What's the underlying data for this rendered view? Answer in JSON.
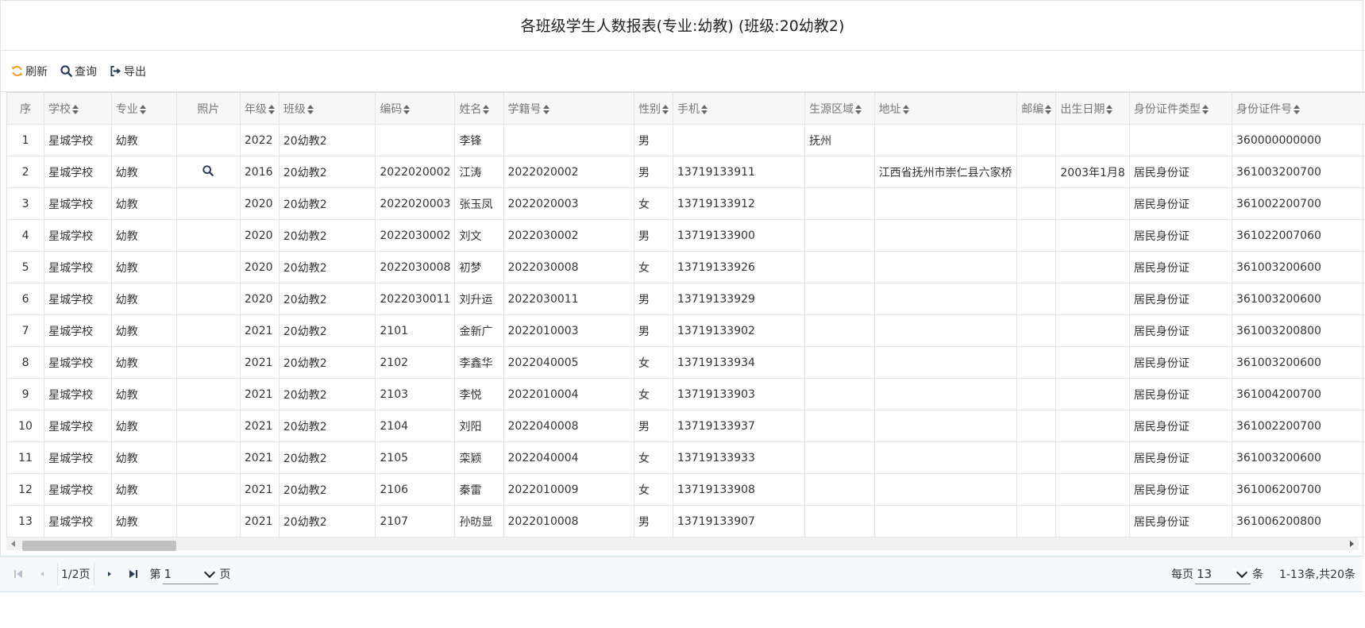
{
  "report": {
    "title": "各班级学生人数报表(专业:幼教) (班级:20幼教2)"
  },
  "toolbar": {
    "refresh_label": "刷新",
    "query_label": "查询",
    "export_label": "导出",
    "refresh_color": "#f0a030"
  },
  "table": {
    "columns": [
      "序",
      "学校",
      "专业",
      "照片",
      "年级",
      "班级",
      "编码",
      "姓名",
      "学籍号",
      "性别",
      "手机",
      "生源区域",
      "地址",
      "邮编",
      "出生日期",
      "身份证件类型",
      "身份证件号"
    ],
    "rows": [
      {
        "seq": "1",
        "school": "星城学校",
        "major": "幼教",
        "photo": "",
        "grade": "2022",
        "class": "20幼教2",
        "code": "",
        "name": "李锋",
        "sid": "",
        "gender": "男",
        "phone": "",
        "region": "抚州",
        "addr": "",
        "zip": "",
        "birth": "",
        "idtype": "",
        "idno": "360000000000"
      },
      {
        "seq": "2",
        "school": "星城学校",
        "major": "幼教",
        "photo": "search-icon",
        "grade": "2016",
        "class": "20幼教2",
        "code": "2022020002",
        "name": "江涛",
        "sid": "2022020002",
        "gender": "男",
        "phone": "13719133911",
        "region": "",
        "addr": "江西省抚州市崇仁县六家桥",
        "zip": "",
        "birth": "2003年1月8",
        "idtype": "居民身份证",
        "idno": "361003200700"
      },
      {
        "seq": "3",
        "school": "星城学校",
        "major": "幼教",
        "photo": "",
        "grade": "2020",
        "class": "20幼教2",
        "code": "2022020003",
        "name": "张玉凤",
        "sid": "2022020003",
        "gender": "女",
        "phone": "13719133912",
        "region": "",
        "addr": "",
        "zip": "",
        "birth": "",
        "idtype": "居民身份证",
        "idno": "361002200700"
      },
      {
        "seq": "4",
        "school": "星城学校",
        "major": "幼教",
        "photo": "",
        "grade": "2020",
        "class": "20幼教2",
        "code": "2022030002",
        "name": "刘文",
        "sid": "2022030002",
        "gender": "男",
        "phone": "13719133900",
        "region": "",
        "addr": "",
        "zip": "",
        "birth": "",
        "idtype": "居民身份证",
        "idno": "361022007060"
      },
      {
        "seq": "5",
        "school": "星城学校",
        "major": "幼教",
        "photo": "",
        "grade": "2020",
        "class": "20幼教2",
        "code": "2022030008",
        "name": "初梦",
        "sid": "2022030008",
        "gender": "女",
        "phone": "13719133926",
        "region": "",
        "addr": "",
        "zip": "",
        "birth": "",
        "idtype": "居民身份证",
        "idno": "361003200600"
      },
      {
        "seq": "6",
        "school": "星城学校",
        "major": "幼教",
        "photo": "",
        "grade": "2020",
        "class": "20幼教2",
        "code": "2022030011",
        "name": "刘升运",
        "sid": "2022030011",
        "gender": "男",
        "phone": "13719133929",
        "region": "",
        "addr": "",
        "zip": "",
        "birth": "",
        "idtype": "居民身份证",
        "idno": "361003200600"
      },
      {
        "seq": "7",
        "school": "星城学校",
        "major": "幼教",
        "photo": "",
        "grade": "2021",
        "class": "20幼教2",
        "code": "2101",
        "name": "金新广",
        "sid": "2022010003",
        "gender": "男",
        "phone": "13719133902",
        "region": "",
        "addr": "",
        "zip": "",
        "birth": "",
        "idtype": "居民身份证",
        "idno": "361003200800"
      },
      {
        "seq": "8",
        "school": "星城学校",
        "major": "幼教",
        "photo": "",
        "grade": "2021",
        "class": "20幼教2",
        "code": "2102",
        "name": "李鑫华",
        "sid": "2022040005",
        "gender": "女",
        "phone": "13719133934",
        "region": "",
        "addr": "",
        "zip": "",
        "birth": "",
        "idtype": "居民身份证",
        "idno": "361003200600"
      },
      {
        "seq": "9",
        "school": "星城学校",
        "major": "幼教",
        "photo": "",
        "grade": "2021",
        "class": "20幼教2",
        "code": "2103",
        "name": "李悦",
        "sid": "2022010004",
        "gender": "女",
        "phone": "13719133903",
        "region": "",
        "addr": "",
        "zip": "",
        "birth": "",
        "idtype": "居民身份证",
        "idno": "361004200700"
      },
      {
        "seq": "10",
        "school": "星城学校",
        "major": "幼教",
        "photo": "",
        "grade": "2021",
        "class": "20幼教2",
        "code": "2104",
        "name": "刘阳",
        "sid": "2022040008",
        "gender": "男",
        "phone": "13719133937",
        "region": "",
        "addr": "",
        "zip": "",
        "birth": "",
        "idtype": "居民身份证",
        "idno": "361002200700"
      },
      {
        "seq": "11",
        "school": "星城学校",
        "major": "幼教",
        "photo": "",
        "grade": "2021",
        "class": "20幼教2",
        "code": "2105",
        "name": "栾颖",
        "sid": "2022040004",
        "gender": "女",
        "phone": "13719133933",
        "region": "",
        "addr": "",
        "zip": "",
        "birth": "",
        "idtype": "居民身份证",
        "idno": "361003200600"
      },
      {
        "seq": "12",
        "school": "星城学校",
        "major": "幼教",
        "photo": "",
        "grade": "2021",
        "class": "20幼教2",
        "code": "2106",
        "name": "秦雷",
        "sid": "2022010009",
        "gender": "女",
        "phone": "13719133908",
        "region": "",
        "addr": "",
        "zip": "",
        "birth": "",
        "idtype": "居民身份证",
        "idno": "361006200700"
      },
      {
        "seq": "13",
        "school": "星城学校",
        "major": "幼教",
        "photo": "",
        "grade": "2021",
        "class": "20幼教2",
        "code": "2107",
        "name": "孙昉显",
        "sid": "2022010008",
        "gender": "男",
        "phone": "13719133907",
        "region": "",
        "addr": "",
        "zip": "",
        "birth": "",
        "idtype": "居民身份证",
        "idno": "361006200800"
      }
    ]
  },
  "pager": {
    "page_info": "1/2页",
    "goto_prefix": "第",
    "goto_value": "1",
    "goto_suffix": "页",
    "per_page_prefix": "每页",
    "per_page_value": "13",
    "per_page_suffix": "条",
    "summary": "1-13条,共20条"
  }
}
